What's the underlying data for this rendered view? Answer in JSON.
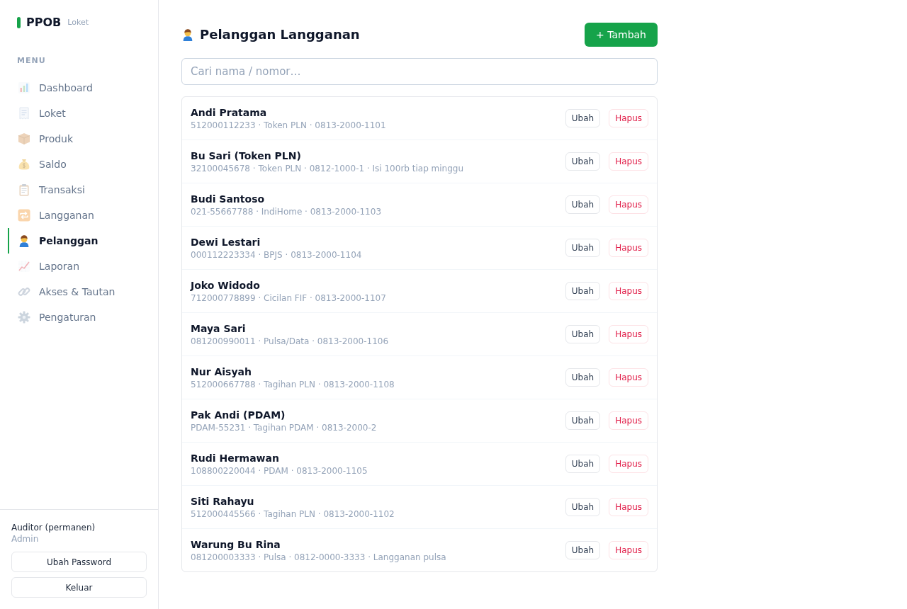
{
  "sidebar": {
    "brand": "PPOB",
    "brand_sub": "Loket",
    "menu_label": "MENU",
    "items": [
      {
        "label": "Dashboard",
        "kind": "chart",
        "selected": false
      },
      {
        "label": "Loket",
        "kind": "receipt",
        "selected": false
      },
      {
        "label": "Produk",
        "kind": "package",
        "selected": false
      },
      {
        "label": "Saldo",
        "kind": "money",
        "selected": false
      },
      {
        "label": "Transaksi",
        "kind": "clipboard",
        "selected": false
      },
      {
        "label": "Langganan",
        "kind": "repeat",
        "selected": false
      },
      {
        "label": "Pelanggan",
        "kind": "person",
        "selected": true
      },
      {
        "label": "Laporan",
        "kind": "trend",
        "selected": false
      },
      {
        "label": "Akses & Tautan",
        "kind": "link",
        "selected": false
      },
      {
        "label": "Pengaturan",
        "kind": "gear",
        "selected": false
      }
    ],
    "user": {
      "name": "Auditor (permanen)",
      "role": "Admin"
    },
    "buttons": [
      "Ubah Password",
      "Keluar"
    ]
  },
  "main": {
    "title": "Pelanggan Langganan",
    "add_button": "+ Tambah",
    "search": {
      "placeholder": "Cari nama / nomor…"
    },
    "customers": [
      {
        "name": "Andi Pratama",
        "details": "512000112233 · Token PLN · 0813-2000-1101",
        "edit": "Ubah",
        "delete": "Hapus"
      },
      {
        "name": "Bu Sari (Token PLN)",
        "details": "32100045678 · Token PLN · 0812-1000-1 · Isi 100rb tiap minggu",
        "edit": "Ubah",
        "delete": "Hapus"
      },
      {
        "name": "Budi Santoso",
        "details": "021-55667788 · IndiHome · 0813-2000-1103",
        "edit": "Ubah",
        "delete": "Hapus"
      },
      {
        "name": "Dewi Lestari",
        "details": "000112223334 · BPJS · 0813-2000-1104",
        "edit": "Ubah",
        "delete": "Hapus"
      },
      {
        "name": "Joko Widodo",
        "details": "712000778899 · Cicilan FIF · 0813-2000-1107",
        "edit": "Ubah",
        "delete": "Hapus"
      },
      {
        "name": "Maya Sari",
        "details": "081200990011 · Pulsa/Data · 0813-2000-1106",
        "edit": "Ubah",
        "delete": "Hapus"
      },
      {
        "name": "Nur Aisyah",
        "details": "512000667788 · Tagihan PLN · 0813-2000-1108",
        "edit": "Ubah",
        "delete": "Hapus"
      },
      {
        "name": "Pak Andi (PDAM)",
        "details": "PDAM-55231 · Tagihan PDAM · 0813-2000-2",
        "edit": "Ubah",
        "delete": "Hapus"
      },
      {
        "name": "Rudi Hermawan",
        "details": "108800220044 · PDAM · 0813-2000-1105",
        "edit": "Ubah",
        "delete": "Hapus"
      },
      {
        "name": "Siti Rahayu",
        "details": "512000445566 · Tagihan PLN · 0813-2000-1102",
        "edit": "Ubah",
        "delete": "Hapus"
      },
      {
        "name": "Warung Bu Rina",
        "details": "081200003333 · Pulsa · 0812-0000-3333 · Langganan pulsa",
        "edit": "Ubah",
        "delete": "Hapus"
      }
    ]
  }
}
